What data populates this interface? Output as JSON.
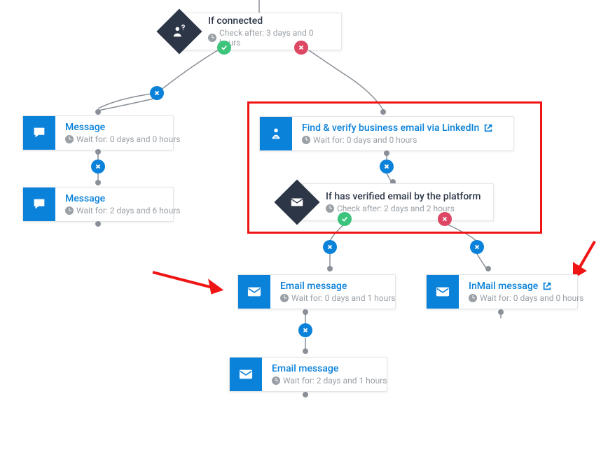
{
  "colors": {
    "primary": "#0b82da",
    "dark": "#2d3647",
    "muted": "#9aa0a6",
    "green": "#3cc47c",
    "red": "#dd4764",
    "highlight": "#f01515"
  },
  "nodes": {
    "ifConnected": {
      "title": "If connected",
      "sub": "Check after: 3 days and 0 hours"
    },
    "msg1": {
      "title": "Message",
      "sub": "Wait for: 0 days and 0 hours"
    },
    "msg2": {
      "title": "Message",
      "sub": "Wait for: 2 days and 6 hours"
    },
    "findEmail": {
      "title": "Find & verify business email via LinkedIn",
      "sub": "Wait for: 0 days and 0 hours"
    },
    "ifVerified": {
      "title": "If has verified email by the platform",
      "sub": "Check after: 2 days and 2 hours"
    },
    "email1": {
      "title": "Email message",
      "sub": "Wait for: 0 days and 1 hours"
    },
    "email2": {
      "title": "Email message",
      "sub": "Wait for: 2 days and 1 hours"
    },
    "inmail": {
      "title": "InMail message",
      "sub": "Wait for: 0 days and 0 hours"
    }
  }
}
